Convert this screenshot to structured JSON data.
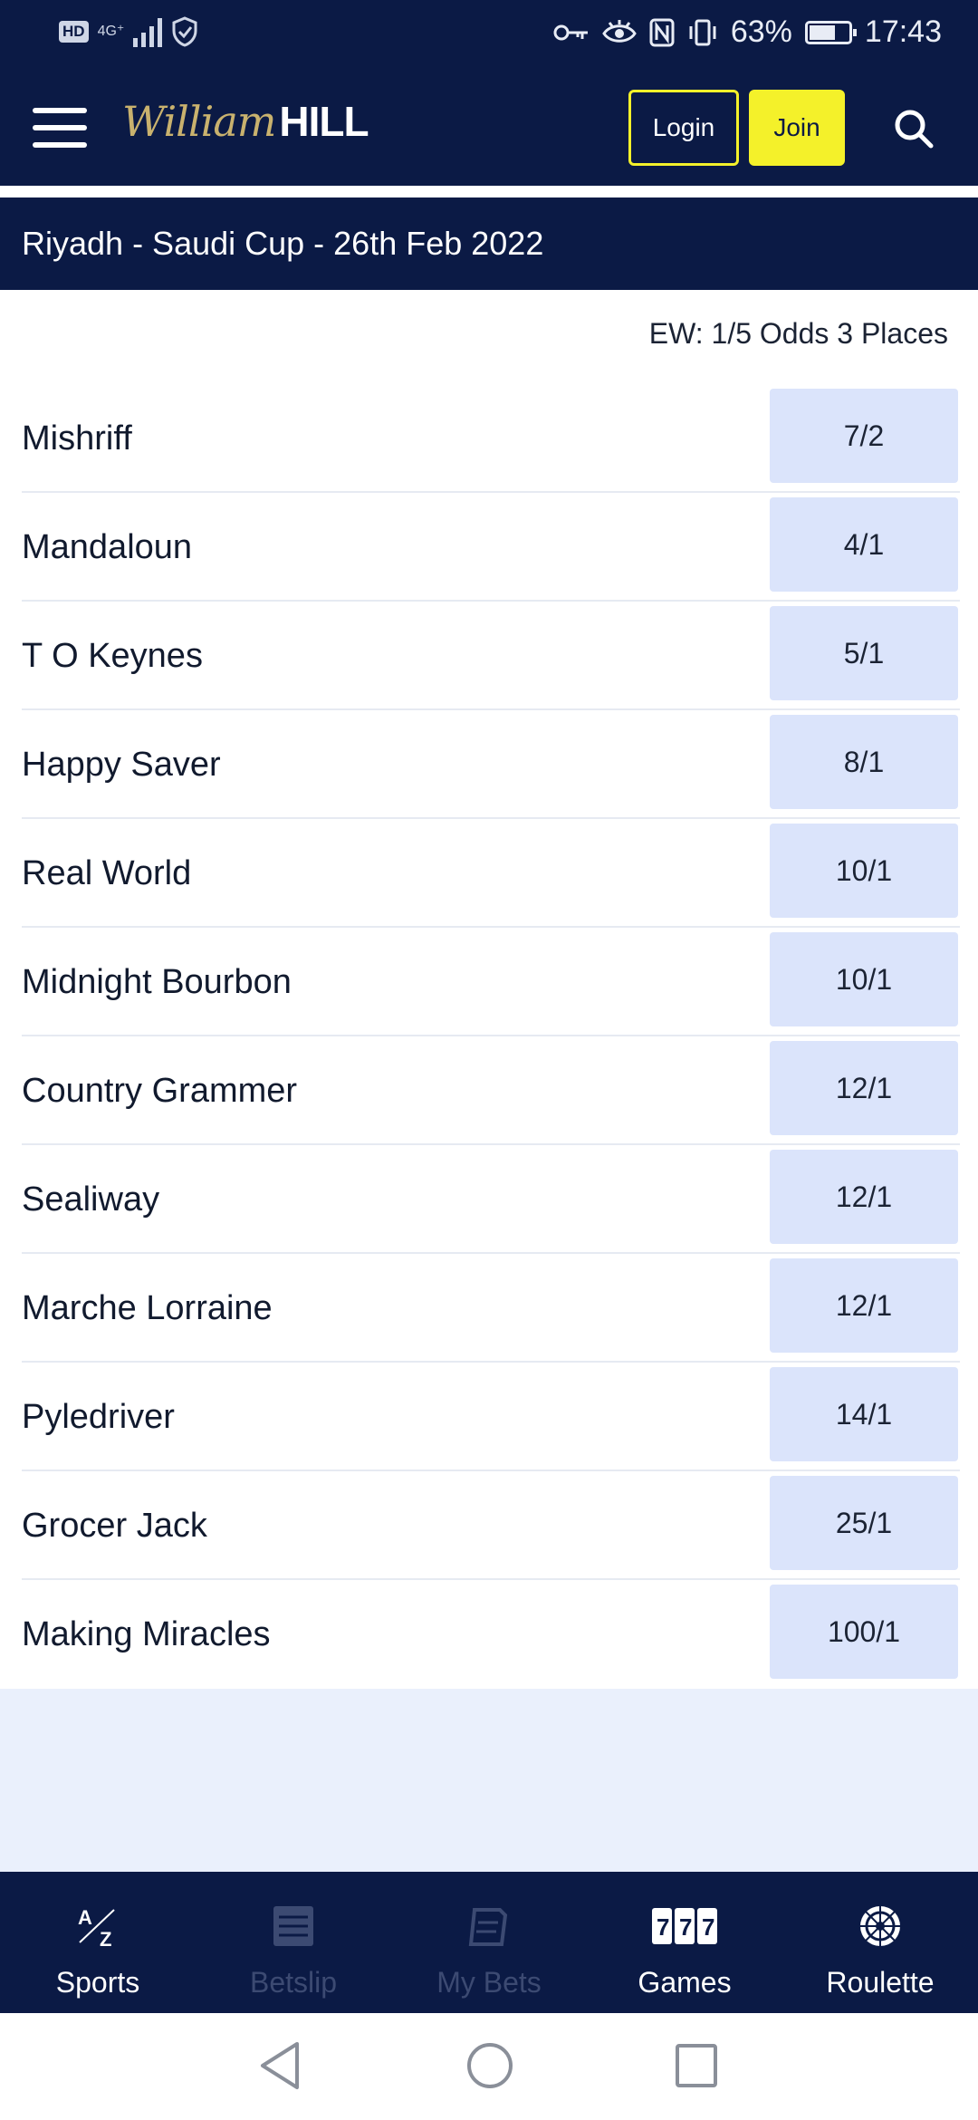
{
  "status_bar": {
    "hd": "HD",
    "network": "4G⁺",
    "battery": "63%",
    "time": "17:43"
  },
  "header": {
    "logo_script": "William",
    "logo_bold": "HILL",
    "login_label": "Login",
    "join_label": "Join"
  },
  "race": {
    "title": "Riyadh - Saudi Cup - 26th Feb 2022",
    "ew_terms": "EW: 1/5 Odds 3 Places"
  },
  "runners": [
    {
      "name": "Mishriff",
      "odds": "7/2"
    },
    {
      "name": "Mandaloun",
      "odds": "4/1"
    },
    {
      "name": "T O Keynes",
      "odds": "5/1"
    },
    {
      "name": "Happy Saver",
      "odds": "8/1"
    },
    {
      "name": "Real World",
      "odds": "10/1"
    },
    {
      "name": "Midnight Bourbon",
      "odds": "10/1"
    },
    {
      "name": "Country Grammer",
      "odds": "12/1"
    },
    {
      "name": "Sealiway",
      "odds": "12/1"
    },
    {
      "name": "Marche Lorraine",
      "odds": "12/1"
    },
    {
      "name": "Pyledriver",
      "odds": "14/1"
    },
    {
      "name": "Grocer Jack",
      "odds": "25/1"
    },
    {
      "name": "Making Miracles",
      "odds": "100/1"
    }
  ],
  "bottom_nav": [
    {
      "label": "Sports",
      "icon": "a-z-icon",
      "active": true
    },
    {
      "label": "Betslip",
      "icon": "betslip-icon",
      "active": false
    },
    {
      "label": "My Bets",
      "icon": "my-bets-icon",
      "active": false
    },
    {
      "label": "Games",
      "icon": "slots-777-icon",
      "active": true
    },
    {
      "label": "Roulette",
      "icon": "roulette-icon",
      "active": true
    }
  ],
  "colors": {
    "brand_navy": "#0b1a45",
    "accent_yellow": "#f4f12a",
    "odds_bg": "#dbe4fb",
    "logo_gold": "#c9b26e"
  }
}
